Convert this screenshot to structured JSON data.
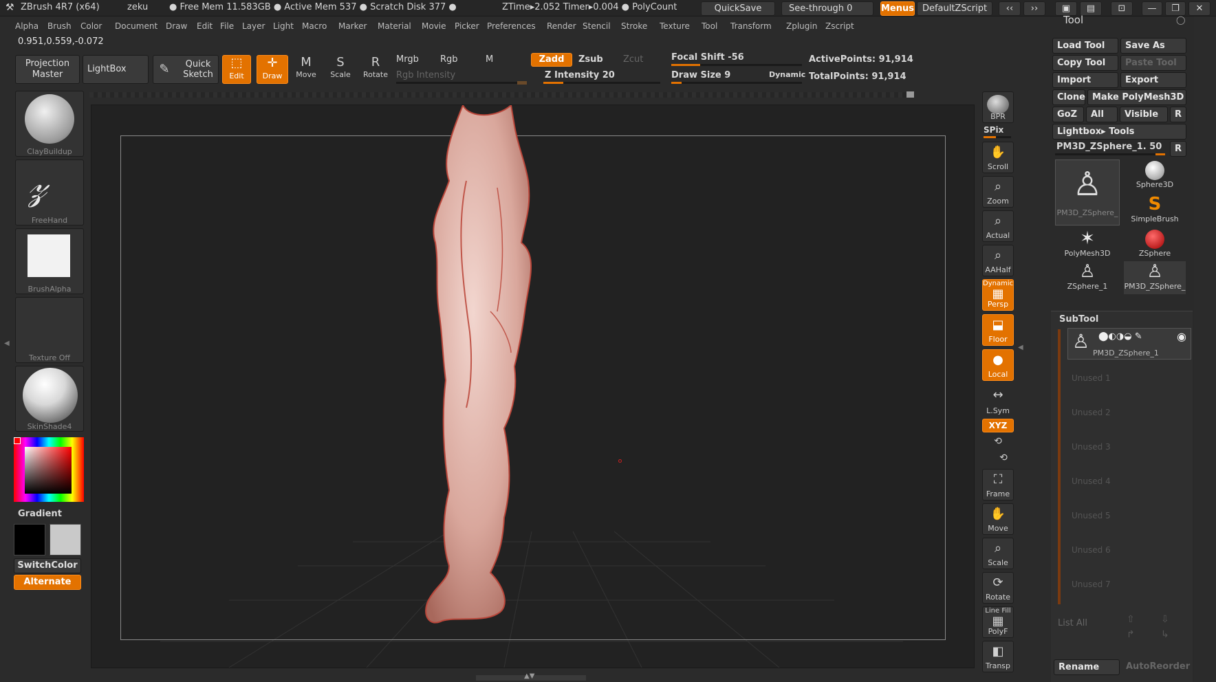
{
  "titlebar": {
    "app": "ZBrush 4R7 (x64)",
    "user": "zeku",
    "free_mem": "● Free Mem 11.583GB ● Active Mem 537 ● Scratch Disk 377 ●",
    "ztime": "ZTime▸2.052  Timer▸0.004 ● PolyCount",
    "quicksave": "QuickSave",
    "seethrough": "See-through   0",
    "menus": "Menus",
    "script": "DefaultZScript"
  },
  "menubar": [
    "Alpha",
    "Brush",
    "Color",
    "Document",
    "Draw",
    "Edit",
    "File",
    "Layer",
    "Light",
    "Macro",
    "Marker",
    "Material",
    "Movie",
    "Picker",
    "Preferences",
    "Render",
    "Stencil",
    "Stroke",
    "Texture",
    "Tool",
    "Transform",
    "Zplugin",
    "Zscript"
  ],
  "coords": "0.951,0.559,-0.072",
  "toolbar": {
    "projection_master": "Projection Master",
    "lightbox": "LightBox",
    "quick_sketch": "Quick Sketch",
    "edit": "Edit",
    "draw": "Draw",
    "move": "Move",
    "scale": "Scale",
    "rotate": "Rotate",
    "mrgb": "Mrgb",
    "rgb": "Rgb",
    "m": "M",
    "zadd": "Zadd",
    "zsub": "Zsub",
    "zcut": "Zcut",
    "rgb_intensity": "Rgb Intensity",
    "z_intensity": "Z Intensity 20",
    "focal_shift": "Focal Shift -56",
    "draw_size": "Draw Size 9",
    "dynamic": "Dynamic",
    "active_points": "ActivePoints: 91,914",
    "total_points": "TotalPoints: 91,914",
    "z_intensity_level": 0.2,
    "draw_size_level": 0.1
  },
  "left": {
    "brush": "ClayBuildup",
    "stroke": "FreeHand",
    "alpha": "BrushAlpha",
    "texture": "Texture Off",
    "material": "SkinShade4",
    "gradient": "Gradient",
    "switch": "SwitchColor",
    "alternate": "Alternate"
  },
  "righttools": {
    "bpr": "BPR",
    "spix": "SPix",
    "scroll": "Scroll",
    "zoom": "Zoom",
    "actual": "Actual",
    "aahalf": "AAHalf",
    "dynamic": "Dynamic",
    "persp": "Persp",
    "floor": "Floor",
    "local": "Local",
    "lsym": "L.Sym",
    "xyz": "XYZ",
    "frame": "Frame",
    "move": "Move",
    "scale": "Scale",
    "rotate": "Rotate",
    "linefill": "Line Fill",
    "polyf": "PolyF",
    "transp": "Transp"
  },
  "tool_panel": {
    "title": "Tool",
    "load": "Load Tool",
    "save_as": "Save As",
    "copy": "Copy Tool",
    "paste": "Paste Tool",
    "import": "Import",
    "export": "Export",
    "clone": "Clone",
    "make_poly": "Make PolyMesh3D",
    "goz": "GoZ",
    "all": "All",
    "visible": "Visible",
    "r": "R",
    "lightbox_tools": "Lightbox▸ Tools",
    "current": "PM3D_ZSphere_1. 50",
    "tiles": [
      "PM3D_ZSphere_",
      "Sphere3D",
      "SimpleBrush",
      "PolyMesh3D",
      "ZSphere",
      "ZSphere_1",
      "PM3D_ZSphere_"
    ],
    "subtool": "SubTool",
    "subtool_name": "PM3D_ZSphere_1",
    "unused": [
      "Unused 1",
      "Unused 2",
      "Unused 3",
      "Unused 4",
      "Unused 5",
      "Unused 6",
      "Unused 7"
    ],
    "list_all": "List All",
    "rename": "Rename",
    "autoreorder": "AutoReorder"
  },
  "colors": {
    "accent": "#e37200"
  }
}
